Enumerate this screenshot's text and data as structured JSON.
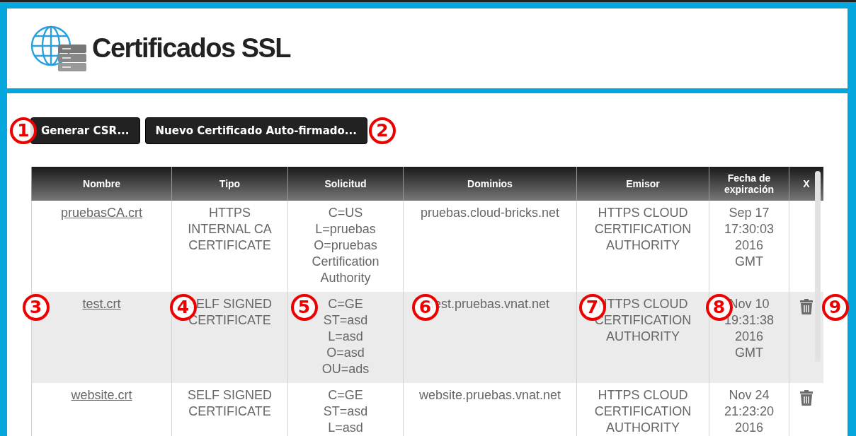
{
  "header": {
    "title": "Certificados SSL"
  },
  "toolbar": [
    {
      "kind": "callout",
      "number": "1"
    },
    {
      "kind": "button",
      "label": "Generar CSR..."
    },
    {
      "kind": "button",
      "label": "Nuevo Certificado Auto-firmado..."
    },
    {
      "kind": "callout",
      "number": "2"
    }
  ],
  "table": {
    "columns": [
      "Nombre",
      "Tipo",
      "Solicitud",
      "Dominios",
      "Emisor",
      "Fecha de expiración",
      "X"
    ],
    "rows": [
      {
        "selected": false,
        "name": "pruebasCA.crt",
        "type": "HTTPS INTERNAL CA CERTIFICATE",
        "request": [
          "C=US",
          "L=pruebas",
          "O=pruebas Certification Authority"
        ],
        "domains": "pruebas.cloud-bricks.net",
        "issuer": "HTTPS CLOUD CERTIFICATION AUTHORITY",
        "expiry": "Sep 17 17:30:03 2016 GMT",
        "deletable": false,
        "callouts": []
      },
      {
        "selected": true,
        "name": "test.crt",
        "type": "SELF SIGNED CERTIFICATE",
        "request": [
          "C=GE",
          "ST=asd",
          "L=asd",
          "O=asd",
          "OU=ads"
        ],
        "domains": "test.pruebas.vnat.net",
        "issuer": "HTTPS CLOUD CERTIFICATION AUTHORITY",
        "expiry": "Nov 10 19:31:38 2016 GMT",
        "deletable": true,
        "callouts": [
          "3",
          "4",
          "5",
          "6",
          "7",
          "8",
          "9"
        ]
      },
      {
        "selected": false,
        "name": "website.crt",
        "type": "SELF SIGNED CERTIFICATE",
        "request": [
          "C=GE",
          "ST=asd",
          "L=asd"
        ],
        "domains": "website.pruebas.vnat.net",
        "issuer": "HTTPS CLOUD CERTIFICATION AUTHORITY",
        "expiry": "Nov 24 21:23:20 2016",
        "deletable": true,
        "callouts": []
      }
    ]
  }
}
